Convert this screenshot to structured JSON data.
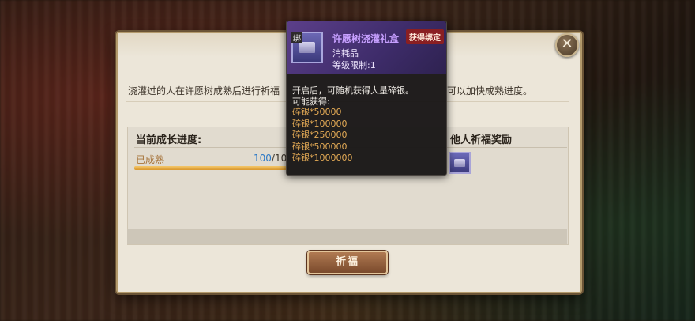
{
  "dialog": {
    "description_left": "浇灌过的人在许愿树成熟后进行祈福",
    "description_right": "可以加快成熟进度。",
    "progress_label": "当前成长进度:",
    "status_text": "已成熟",
    "progress_current": "100",
    "progress_total": "/10",
    "progress_fraction": 1.0,
    "reward_label": "他人祈福奖励",
    "pray_button": "祈福",
    "close_icon": "close-icon"
  },
  "tooltip": {
    "bind_mark": "绑",
    "title": "许愿树浇灌礼盒",
    "badge": "获得绑定",
    "type": "消耗品",
    "level": "等级限制:1",
    "description": "开启后，可随机获得大量碎银。",
    "possible_label": "可能获得:",
    "rewards": [
      "碎银*50000",
      "碎银*100000",
      "碎银*250000",
      "碎银*500000",
      "碎银*1000000"
    ]
  },
  "colors": {
    "tooltip_title": "#c7a0ff",
    "reward_text": "#e3aa55",
    "badge_bg": "#8a1f22",
    "progress_count": "#2a78c6"
  }
}
